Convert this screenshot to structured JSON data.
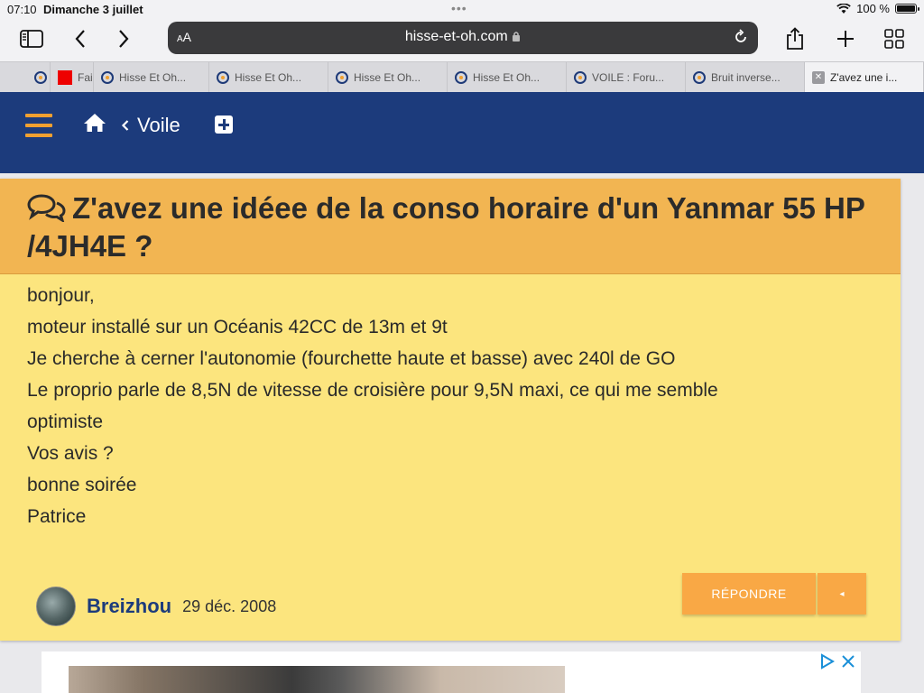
{
  "status": {
    "time": "07:10",
    "date": "Dimanche 3 juillet",
    "battery": "100 %"
  },
  "toolbar": {
    "aa_small": "A",
    "aa_big": "A",
    "host": "hisse-et-oh.com"
  },
  "tabs": [
    {
      "label": "",
      "icon": "site-favicon"
    },
    {
      "label": "Fai",
      "icon": "red-square"
    },
    {
      "label": "Hisse Et Oh...",
      "icon": "site-favicon"
    },
    {
      "label": "Hisse Et Oh...",
      "icon": "site-favicon"
    },
    {
      "label": "Hisse Et Oh...",
      "icon": "site-favicon"
    },
    {
      "label": "Hisse Et Oh...",
      "icon": "site-favicon"
    },
    {
      "label": "VOILE : Foru...",
      "icon": "site-favicon"
    },
    {
      "label": "Bruit inverse...",
      "icon": "site-favicon"
    },
    {
      "label": "Z'avez une i...",
      "icon": "close-icon"
    }
  ],
  "site": {
    "breadcrumb": "Voile"
  },
  "post": {
    "title": "Z'avez une idéee de la conso horaire d'un Yanmar 55 HP /4JH4E ?",
    "lines": [
      "bonjour,",
      "moteur installé sur un Océanis 42CC de 13m et 9t",
      "Je cherche à cerner l'autonomie (fourchette haute et basse) avec 240l de GO",
      "Le proprio parle de 8,5N de vitesse de croisière pour 9,5N maxi, ce qui me semble",
      "optimiste",
      "Vos avis ?",
      "bonne soirée",
      "Patrice"
    ],
    "author": "Breizhou",
    "date": "29 déc. 2008",
    "reply_label": "RÉPONDRE",
    "more_label": "◂"
  },
  "colors": {
    "header": "#1c3b7c",
    "accent": "#f0a030",
    "card": "#fce57e",
    "card_head": "#f2b552",
    "button": "#f9a845"
  }
}
